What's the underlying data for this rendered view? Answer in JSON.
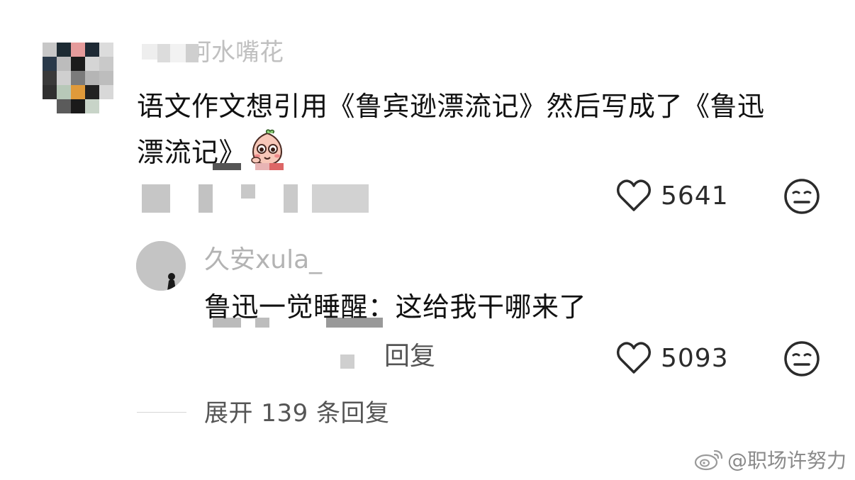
{
  "comment": {
    "username": "嗨呵呵水嘴花",
    "text_line1": "语文作文想引用《鲁宾逊漂流记》然后写成了《鲁迅",
    "text_line2": "漂流记》",
    "emoji_icon": "peach-face-emoji",
    "like_count": "5641",
    "like_icon": "heart-outline-icon",
    "dislike_icon": "meh-face-icon"
  },
  "reply": {
    "username": "久安xula_",
    "text": "鲁迅一觉睡醒：这给我干哪来了",
    "reply_label": "回复",
    "like_count": "5093",
    "like_icon": "heart-outline-icon",
    "dislike_icon": "meh-face-icon"
  },
  "expand": {
    "label": "展开 139 条回复"
  },
  "watermark": {
    "text": "@职场许努力",
    "logo_icon": "weibo-logo-icon"
  },
  "colors": {
    "text_primary": "#111111",
    "text_secondary": "#555555",
    "username_gray": "#b8b8b8",
    "icon_stroke": "#2b2b2b"
  }
}
